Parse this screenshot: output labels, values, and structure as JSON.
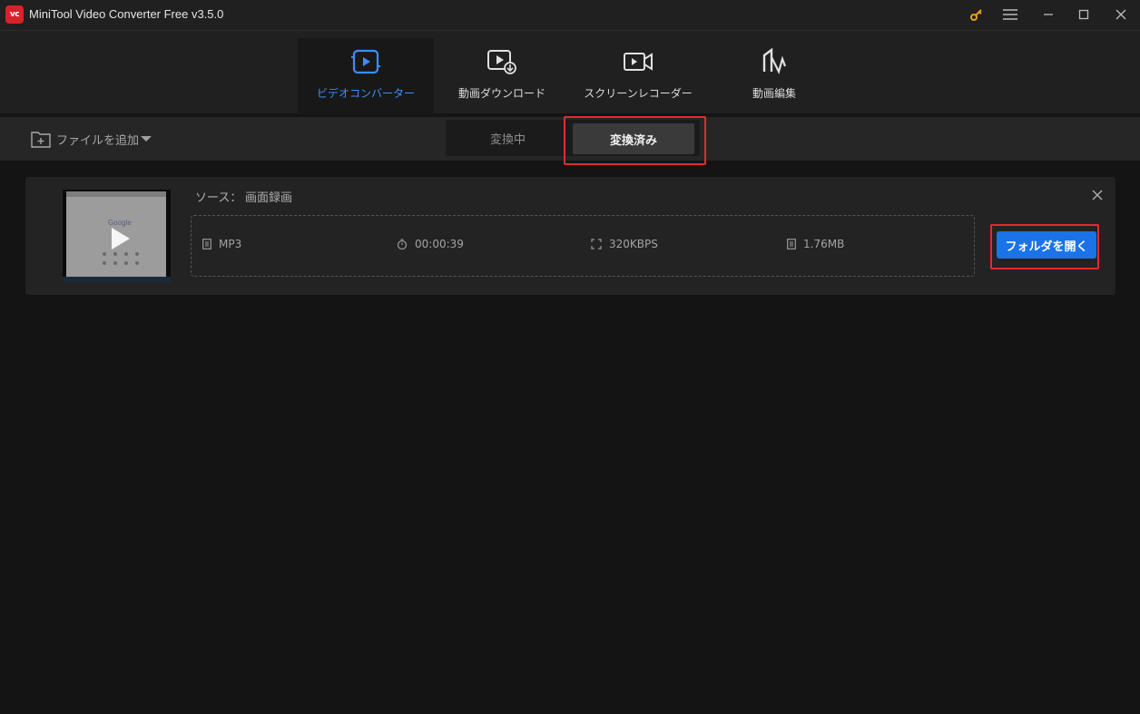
{
  "window": {
    "title": "MiniTool Video Converter Free v3.5.0",
    "logo_text": "vc"
  },
  "nav": {
    "items": [
      {
        "label": "ビデオコンバーター",
        "icon": "convert-icon",
        "active": true
      },
      {
        "label": "動画ダウンロード",
        "icon": "download-video-icon",
        "active": false
      },
      {
        "label": "スクリーンレコーダー",
        "icon": "screen-recorder-icon",
        "active": false
      },
      {
        "label": "動画編集",
        "icon": "video-edit-icon",
        "active": false
      }
    ]
  },
  "toolbar": {
    "add_file_label": "ファイルを追加",
    "tabs": [
      {
        "label": "変換中",
        "selected": false
      },
      {
        "label": "変換済み",
        "selected": true
      }
    ]
  },
  "file_card": {
    "source_label": "ソース：",
    "source_value": "画面録画",
    "thumbnail_text": "Google",
    "format": "MP3",
    "duration": "00:00:39",
    "bitrate": "320KBPS",
    "size": "1.76MB",
    "open_folder_label": "フォルダを開く"
  },
  "colors": {
    "accent_blue": "#1a73e8",
    "active_nav": "#3c8dff",
    "highlight_red": "#e52a2a",
    "key_icon": "#e8a317"
  }
}
